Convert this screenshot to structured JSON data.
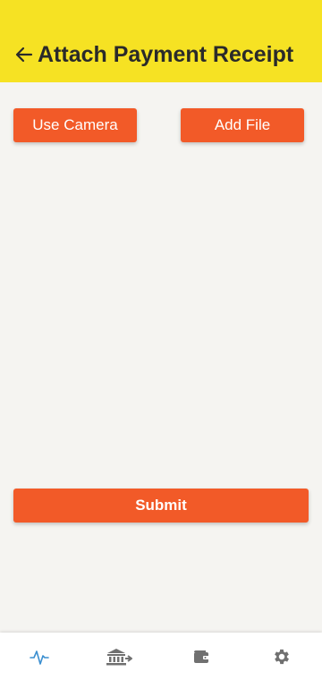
{
  "header": {
    "title": "Attach Payment Receipt",
    "back_icon": "arrow-left-icon"
  },
  "actions": {
    "camera_label": "Use Camera",
    "file_label": "Add File"
  },
  "form": {
    "submit_label": "Submit"
  },
  "bottom_nav": {
    "items": [
      {
        "icon": "activity-icon",
        "active": true
      },
      {
        "icon": "bank-transfer-icon",
        "active": false
      },
      {
        "icon": "wallet-icon",
        "active": false
      },
      {
        "icon": "gear-icon",
        "active": false
      }
    ]
  },
  "colors": {
    "header_bg": "#f6e223",
    "accent": "#f25a28",
    "background": "#f5f4f1",
    "nav_active": "#3b8fd0",
    "nav_inactive": "#707070"
  }
}
